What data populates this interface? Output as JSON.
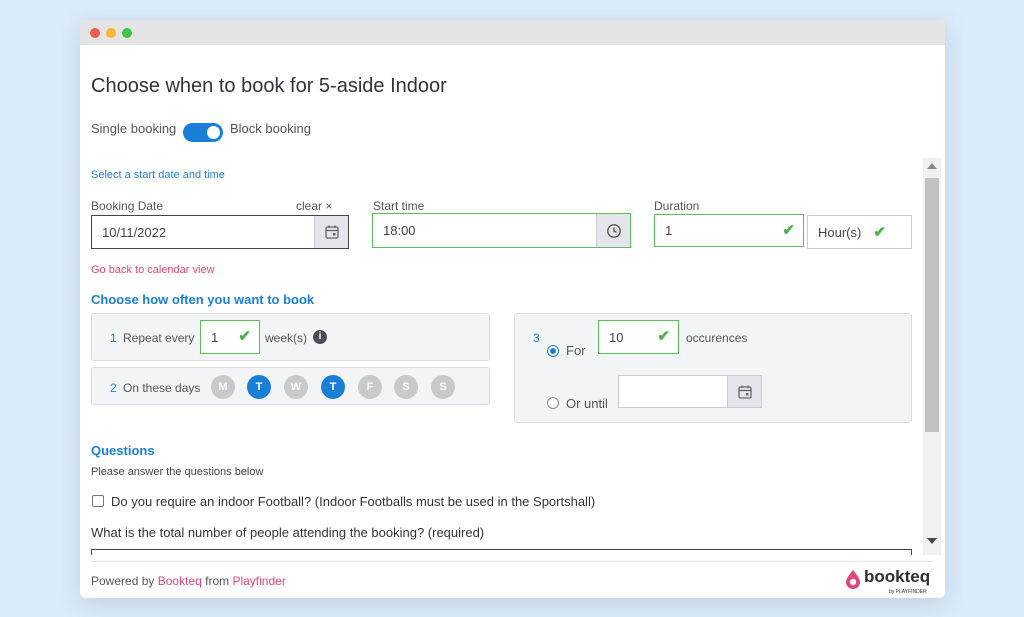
{
  "window": {
    "dot_colors": [
      "#ee5b50",
      "#f5b82e",
      "#3dc44a"
    ]
  },
  "page": {
    "title": "Choose when to book for 5-aside Indoor"
  },
  "booking_type": {
    "single_label": "Single booking",
    "block_label": "Block booking",
    "block_enabled": true
  },
  "datetime": {
    "hint": "Select a start date and time",
    "date_label": "Booking Date",
    "clear_label": "clear ×",
    "date_value": "10/11/2022",
    "start_label": "Start time",
    "start_value": "18:00",
    "duration_label": "Duration",
    "duration_value": "1",
    "duration_unit": "Hour(s)",
    "back_link": "Go back to calendar view"
  },
  "repeat": {
    "heading": "Choose how often you want to book",
    "step1_num": "1",
    "step1_label": "Repeat every",
    "step1_value": "1",
    "step1_unit": "week(s)",
    "step2_num": "2",
    "step2_label": "On these days",
    "days": [
      {
        "label": "M",
        "selected": false
      },
      {
        "label": "T",
        "selected": true
      },
      {
        "label": "W",
        "selected": false
      },
      {
        "label": "T",
        "selected": true
      },
      {
        "label": "F",
        "selected": false
      },
      {
        "label": "S",
        "selected": false
      },
      {
        "label": "S",
        "selected": false
      }
    ],
    "step3_num": "3",
    "for_label": "For",
    "for_value": "10",
    "occurrences_label": "occurences",
    "until_label": "Or until",
    "until_value": "",
    "selected_end": "for"
  },
  "questions": {
    "heading": "Questions",
    "subheading": "Please answer the questions below",
    "q1": "Do you require an indoor Football? (Indoor Footballs must be used in the Sportshall)",
    "q1_checked": false,
    "q2": "What is the total number of people attending the booking? (required)"
  },
  "footer": {
    "powered_by": "Powered by",
    "bookteq_link": "Bookteq",
    "from": "from",
    "playfinder_link": "Playfinder",
    "logo_text": "bookteq",
    "logo_sub": "by PLAYFINDER"
  },
  "colors": {
    "accent": "#1a7fd6",
    "success": "#4cae4c",
    "link": "#e0457b"
  }
}
